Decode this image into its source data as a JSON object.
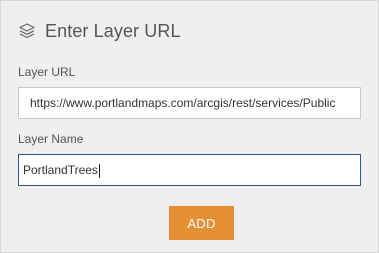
{
  "header": {
    "icon": "layers-icon",
    "title": "Enter Layer URL"
  },
  "form": {
    "url_label": "Layer URL",
    "url_value": "https://www.portlandmaps.com/arcgis/rest/services/Public",
    "name_label": "Layer Name",
    "name_value": "PortlandTrees",
    "add_label": "ADD"
  },
  "colors": {
    "panel_bg": "#efefef",
    "accent": "#e68f33",
    "focus_border": "#2b5b8e"
  }
}
